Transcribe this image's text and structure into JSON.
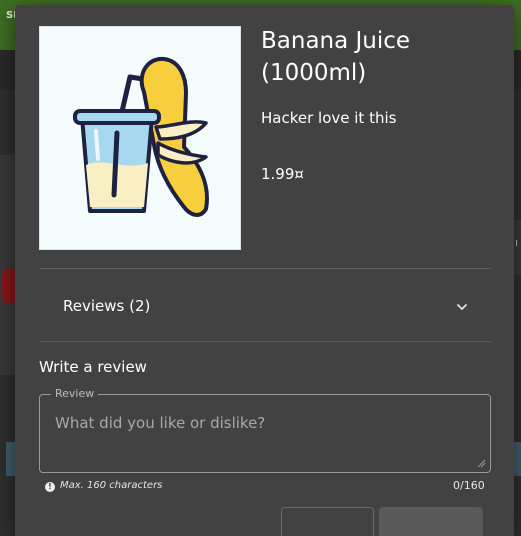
{
  "background": {
    "topbar_text": "SI",
    "right_glyph": "ı"
  },
  "product": {
    "image_alt": "Banana Juice illustration",
    "name": "Banana Juice (1000ml)",
    "description": "Hacker love it this",
    "price": "1.99¤"
  },
  "reviews": {
    "title": "Reviews (2)",
    "expand_icon": "chevron-down-icon"
  },
  "write_review": {
    "heading": "Write a review",
    "field_label": "Review",
    "placeholder": "What did you like or dislike?",
    "hint": "Max. 160 characters",
    "hint_icon": "info-icon",
    "counter": "0/160"
  },
  "colors": {
    "modal_bg": "#424242",
    "backdrop": "#2f2f2f",
    "topbar": "#3d6f24",
    "image_bg": "#f4fcfd",
    "banana": "#f7cf3e",
    "juice": "#f9efc2",
    "cup": "#a6d8f0",
    "outline": "#1f2140"
  }
}
